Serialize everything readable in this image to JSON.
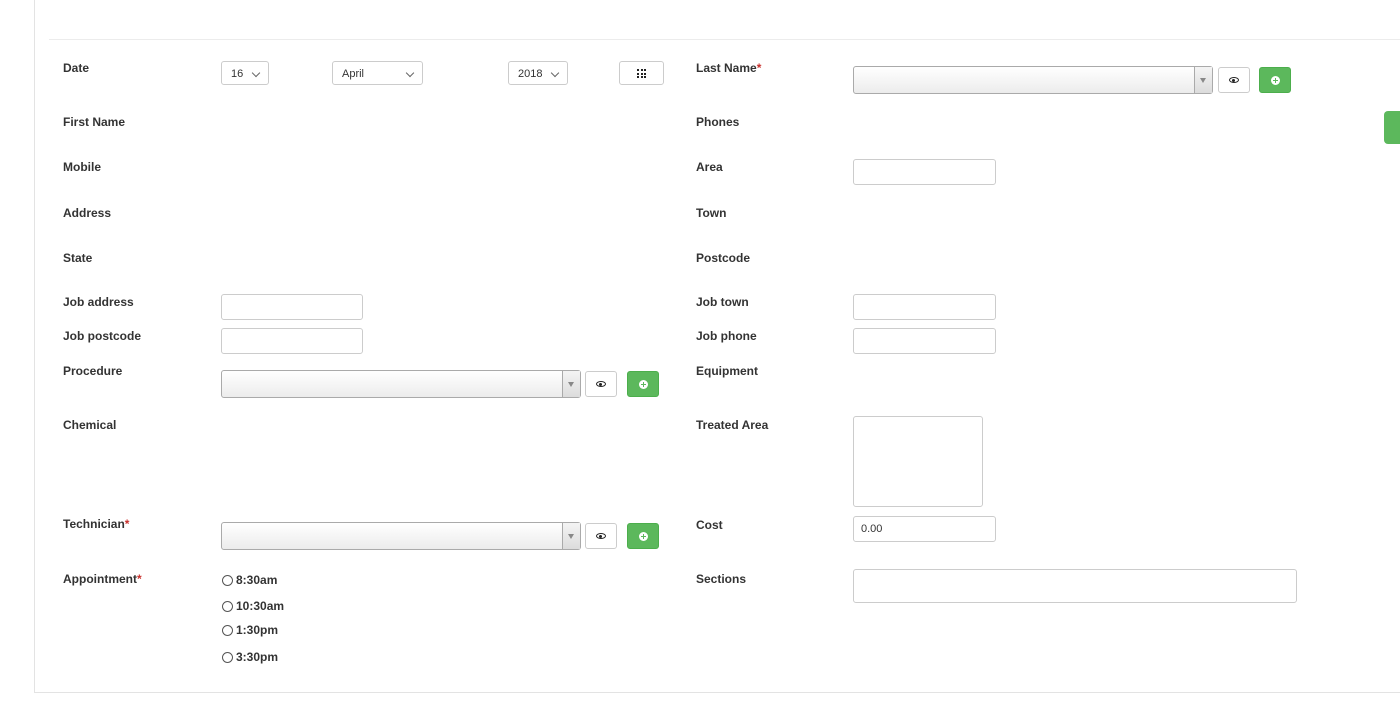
{
  "left": {
    "date_label": "Date",
    "day": "16",
    "month": "April",
    "year": "2018",
    "first_name_label": "First Name",
    "mobile_label": "Mobile",
    "address_label": "Address",
    "state_label": "State",
    "job_address_label": "Job address",
    "job_address_value": "",
    "job_postcode_label": "Job postcode",
    "job_postcode_value": "",
    "procedure_label": "Procedure",
    "chemical_label": "Chemical",
    "technician_label": "Technician",
    "appointment_label": "Appointment",
    "required_mark": "*",
    "appointments": [
      {
        "label": "8:30am"
      },
      {
        "label": "10:30am"
      },
      {
        "label": "1:30pm"
      },
      {
        "label": "3:30pm"
      }
    ]
  },
  "right": {
    "last_name_label": "Last Name",
    "phones_label": "Phones",
    "area_label": "Area",
    "area_value": "",
    "town_label": "Town",
    "postcode_label": "Postcode",
    "job_town_label": "Job town",
    "job_town_value": "",
    "job_phone_label": "Job phone",
    "job_phone_value": "",
    "equipment_label": "Equipment",
    "treated_area_label": "Treated Area",
    "treated_area_value": "",
    "cost_label": "Cost",
    "cost_value": "0.00",
    "sections_label": "Sections",
    "sections_value": ""
  },
  "icons": {
    "calendar": "grid-icon",
    "view": "eye-icon",
    "add": "plus-circle-icon"
  },
  "colors": {
    "accent_green": "#5cb85c",
    "required_red": "#c9302c"
  }
}
